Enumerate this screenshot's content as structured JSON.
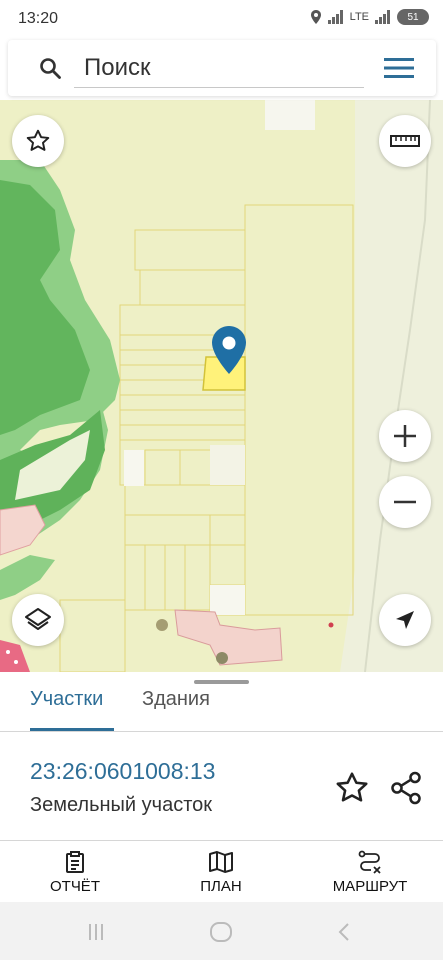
{
  "status_bar": {
    "time": "13:20",
    "network": "LTE",
    "battery": "51"
  },
  "search": {
    "placeholder": "Поиск"
  },
  "sheet": {
    "tabs": [
      {
        "label": "Участки"
      },
      {
        "label": "Здания"
      }
    ],
    "parcel": {
      "cadastral_number": "23:26:0601008:13",
      "type": "Земельный участок"
    }
  },
  "bottom_nav": [
    {
      "label": "ОТЧЁТ",
      "icon": "report-icon"
    },
    {
      "label": "ПЛАН",
      "icon": "map-icon"
    },
    {
      "label": "МАРШРУТ",
      "icon": "route-icon"
    }
  ],
  "colors": {
    "accent": "#2e6e97",
    "map_field": "#eef0c6",
    "parcel_selected": "#fff27a",
    "forest": "#7cc47a",
    "marker": "#1f6fa5"
  }
}
